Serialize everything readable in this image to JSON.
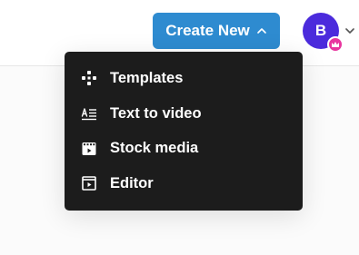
{
  "header": {
    "create_button": {
      "label": "Create New",
      "icon": "chevron-up-icon",
      "color": "#2e8bd0"
    },
    "avatar": {
      "initial": "B",
      "color": "#4b2bdc",
      "badge_icon": "crown-icon",
      "badge_color": "#e8359f",
      "menu_icon": "chevron-down-icon"
    }
  },
  "dropdown": {
    "background": "#1c1c1c",
    "items": [
      {
        "label": "Templates",
        "icon": "templates-icon"
      },
      {
        "label": "Text to video",
        "icon": "text-to-video-icon"
      },
      {
        "label": "Stock media",
        "icon": "stock-media-icon"
      },
      {
        "label": "Editor",
        "icon": "editor-icon"
      }
    ]
  }
}
